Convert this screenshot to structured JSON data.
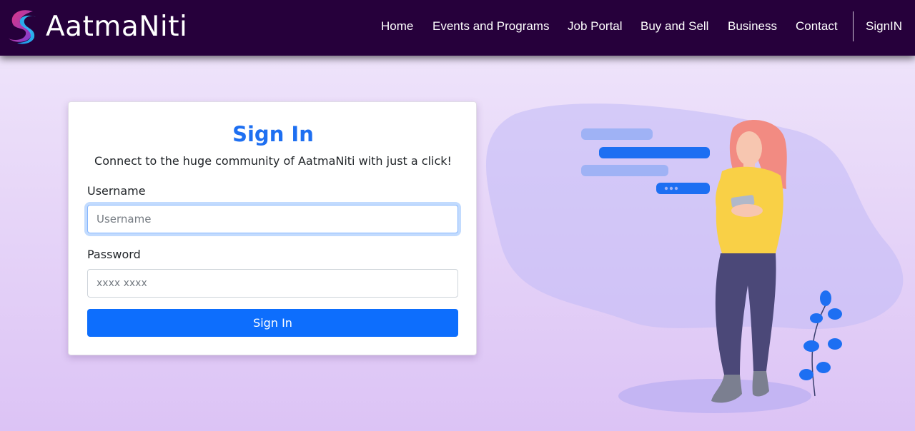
{
  "brand": {
    "name": "AatmaNiti",
    "logo_icon": "swirl-logo-icon"
  },
  "nav": {
    "home": "Home",
    "events": "Events and Programs",
    "jobs": "Job Portal",
    "buysell": "Buy and Sell",
    "business": "Business",
    "contact": "Contact",
    "signin": "SignIN"
  },
  "form": {
    "title": "Sign In",
    "subtitle": "Connect to the huge community of AatmaNiti with just a click!",
    "username_label": "Username",
    "username_placeholder": "Username",
    "username_value": "",
    "password_label": "Password",
    "password_placeholder": "xxxx xxxx",
    "password_value": "",
    "submit_label": "Sign In"
  },
  "colors": {
    "navbar": "#26003b",
    "accent": "#0d6efd",
    "title": "#1e6ff1",
    "background_top": "#f1e8fb",
    "background_bottom": "#dcc3f5"
  },
  "illustration": {
    "icon": "woman-with-phone-chat-illustration"
  }
}
